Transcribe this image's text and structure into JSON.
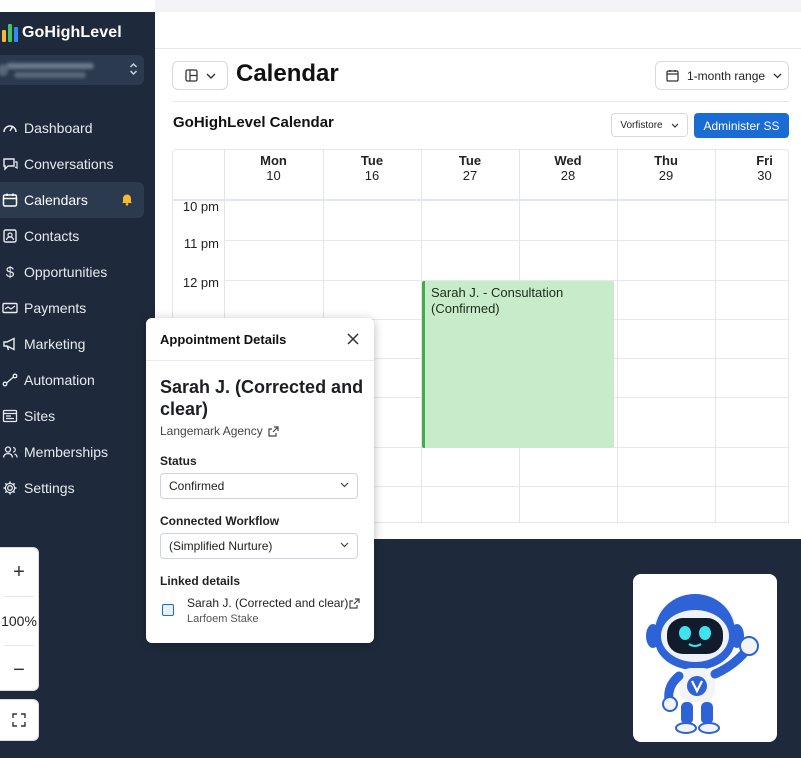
{
  "app": {
    "name": "GoHighLevel",
    "logo_colors": [
      "#f5b82e",
      "#3ec46d",
      "#2f8cf0"
    ]
  },
  "sidebar": {
    "items": [
      {
        "label": "Dashboard",
        "icon": "gauge-icon"
      },
      {
        "label": "Conversations",
        "icon": "chat-icon"
      },
      {
        "label": "Calendars",
        "icon": "calendar-icon",
        "active": true,
        "badge_icon": "bell-icon"
      },
      {
        "label": "Contacts",
        "icon": "contact-card-icon"
      },
      {
        "label": "Opportunities",
        "icon": "dollar-icon"
      },
      {
        "label": "Payments",
        "icon": "card-icon"
      },
      {
        "label": "Marketing",
        "icon": "megaphone-icon"
      },
      {
        "label": "Automation",
        "icon": "flow-icon"
      },
      {
        "label": "Sites",
        "icon": "website-icon"
      },
      {
        "label": "Memberships",
        "icon": "members-icon"
      },
      {
        "label": "Settings",
        "icon": "gear-icon"
      }
    ]
  },
  "zoom": {
    "plus": "+",
    "level": "100%",
    "minus": "−"
  },
  "header": {
    "title": "Calendar",
    "range_label": "1-month range"
  },
  "calendar": {
    "title": "GoHighLevel Calendar",
    "filter_label": "Vorfistore",
    "admin_button": "Administer SS",
    "days": [
      {
        "dow": "Mon",
        "date": "10"
      },
      {
        "dow": "Tue",
        "date": "16"
      },
      {
        "dow": "Tue",
        "date": "27"
      },
      {
        "dow": "Wed",
        "date": "28"
      },
      {
        "dow": "Thu",
        "date": "29"
      },
      {
        "dow": "Fri",
        "date": "30"
      }
    ],
    "times": [
      "10 pm",
      "11 pm",
      "12 pm"
    ],
    "event": {
      "title": "Sarah J. - Consultation (Confirmed)",
      "color": "#c8ecc9",
      "accent": "#3fae4a"
    }
  },
  "popup": {
    "title": "Appointment Details",
    "name": "Sarah J. (Corrected and clear)",
    "agency": "Langemark Agency",
    "status_label": "Status",
    "status_value": "Confirmed",
    "workflow_label": "Connected Workflow",
    "workflow_value": "(Simplified Nurture)",
    "linked_label": "Linked details",
    "linked_title": "Sarah J. (Corrected and clear)",
    "linked_sub": "Larfoem Stake"
  },
  "colors": {
    "sidebar": "#1e2a3b",
    "primary": "#1a6bd3"
  }
}
